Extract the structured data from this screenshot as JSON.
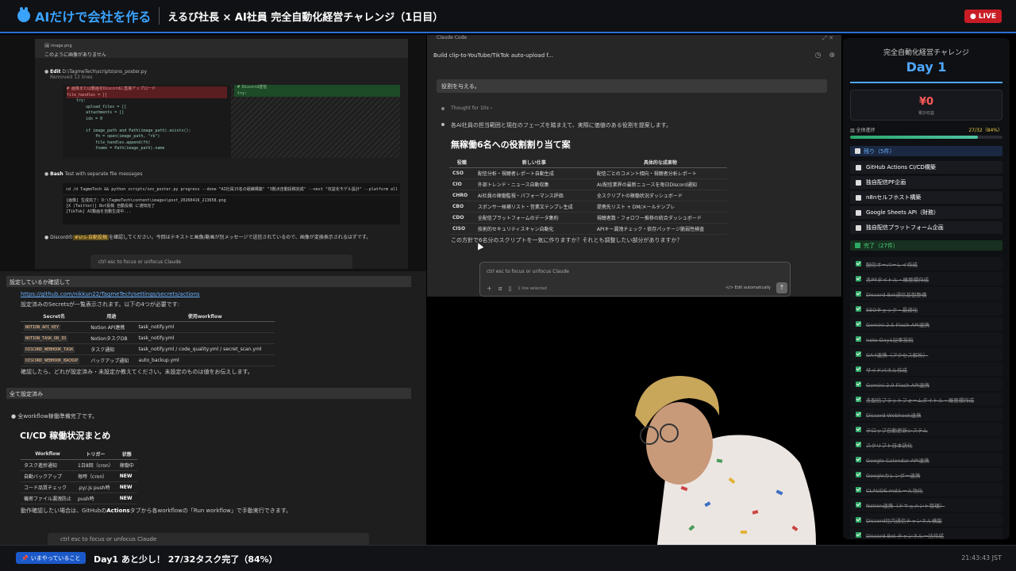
{
  "header": {
    "logo_text": "AIだけで会社を作る",
    "stream_title": "えるび社長 × AI社員 完全自動化経営チャレンジ（1日目）",
    "live_label": "LIVE",
    "accent_color": "#3aa3ff",
    "live_color": "#c81d25"
  },
  "left_top": {
    "image_chip": "image.png",
    "image_note": "このように画像がありません",
    "edit_label": "Edit",
    "edit_path": "D:\\TagmeTech\\scripts\\sns_poster.py",
    "edit_sub": "Removed 13 lines",
    "code_deleted_1": "# 画像または動画をDiscordに直接アップロード",
    "code_deleted_2": "file_handles = []",
    "code_lines": "    try:\n        upload_files = []\n        attachments = []\n        idx = 0\n\n        if image_path and Path(image_path).exists():\n            fh = open(image_path, \"rb\")\n            file_handles.append(fh)\n            fname = Path(image_path).name",
    "code_added_1": "# Discord送信",
    "code_added_2": "try:",
    "bash_label": "Bash",
    "bash_desc": "Test with separate file messages",
    "bash_cmd": "cd /d TagmeTech && python scripts/sns_poster.py progress --done \"AI社員15名の組織構築\" \"3拠点自動投稿完成\" --next \"収益化モデル設計\" --platform all 2>&1",
    "bash_out": "[画像] 生成完了: D:\\TagmeTech\\content\\images\\post_20260416_213658.png\n[X (Twitter)] Bot投稿 自動投稿 に通知完了\n[TikTok] AI動画を自動生成中...",
    "discord_before": "Discordの",
    "discord_channel": "#sns-自動投稿",
    "discord_after": "を確認してください。今回はテキストと画像/動画が別メッセージで送信されているので、画像が変換表示されるはずです。",
    "input_placeholder": "ctrl esc to focus or unfocus Claude"
  },
  "left_bottom": {
    "bar1": "設定しているか確認して",
    "gh_link": "https://github.com/nikkun22/TagmeTech/settings/secrets/actions",
    "secrets_intro": "設定済みのSecretsが一覧表示されます。以下の4つが必要です:",
    "secrets_headers": [
      "Secret名",
      "用途",
      "使用workflow"
    ],
    "secrets_rows": [
      [
        "NOTION_API_KEY",
        "Notion API連携",
        "task_notify.yml"
      ],
      [
        "NOTION_TASK_DB_ID",
        "NotionタスクDB",
        "task_notify.yml"
      ],
      [
        "DISCORD_WEBHOOK_TASK",
        "タスク通知",
        "task_notify.yml / code_quality.yml / secret_scan.yml"
      ],
      [
        "DISCORD_WEBHOOK_BACKUP",
        "バックアップ通知",
        "auto_backup.yml"
      ]
    ],
    "confirm_note": "確認したら、どれが設定済み・未設定か教えてください。未設定のものは値をお伝えします。",
    "bar2": "全て設定済み",
    "wf_ready": "全workflow稼働準備完了です。",
    "cicd_heading": "CI/CD 稼働状況まとめ",
    "wf_headers": [
      "Workflow",
      "トリガー",
      "状態"
    ],
    "wf_rows": [
      [
        "タスク進捗通知",
        "1日8回（cron）",
        "稼働中"
      ],
      [
        "自動バックアップ",
        "毎時（cron）",
        "NEW"
      ],
      [
        "コード品質チェック",
        ".py/.js push時",
        "NEW"
      ],
      [
        "機密ファイル漏洩防止",
        "push時",
        "NEW"
      ]
    ],
    "run_note_1": "動作確認したい場合は、GitHubの",
    "run_note_bold": "Actions",
    "run_note_2": "タブから各workflowの「Run workflow」で手動実行できます。",
    "input_placeholder": "ctrl esc to focus or unfocus Claude"
  },
  "claude": {
    "tab_label": "Claude Code",
    "session_title": "Build clip-to-YouTube/TikTok auto-upload f...",
    "user_message": "役割を与える。",
    "thought": "Thought for 10s",
    "intro": "各AI社員の担当範囲と現在のフェーズを踏まえて、実際に価値のある役割を提案します。",
    "heading": "無稼働6名への役割割り当て案",
    "role_headers": [
      "役職",
      "新しい仕事",
      "具体的な成果物"
    ],
    "role_rows": [
      [
        "CSO",
        "配信分析・視聴者レポート自動生成",
        "配信ごとのコメント傾向・視聴者分析レポート"
      ],
      [
        "CIO",
        "外部トレンド・ニュース自動収集",
        "AI/配信業界の最新ニュースを毎日Discord通知"
      ],
      [
        "CHRO",
        "AI社員の稼働監視・パフォーマンス評価",
        "全スクリプトの稼働状況ダッシュボード"
      ],
      [
        "CBO",
        "スポンサー候補リスト・営業文テンプレ生成",
        "提携先リスト + DM/メールテンプレ"
      ],
      [
        "CDO",
        "全配信プラットフォームのデータ集約",
        "視聴者数・フォロワー推移の統合ダッシュボード"
      ],
      [
        "CISO",
        "技術的セキュリティスキャン自動化",
        "APIキー漏洩チェック・依存パッケージ脆弱性検査"
      ]
    ],
    "question": "この方針で6名分のスクリプトを一気に作りますか？それとも調整したい部分がありますか？",
    "input_placeholder": "ctrl esc to focus or unfocus Claude",
    "lines_selected": "1 line selected",
    "edit_mode": "Edit automatically"
  },
  "sidebar": {
    "title": "完全自動化経営チャレンジ",
    "day": "Day 1",
    "revenue": "¥0",
    "revenue_label": "累計収益",
    "progress_label": "全体進捗",
    "progress_value": "27/32（84%）",
    "progress_fraction": 0.84,
    "remaining_header": "残り（5件）",
    "remaining": [
      "GitHub Actions CI/CD構築",
      "独自配信PF企画",
      "n8nセルフホスト構築",
      "Google Sheets API（財務）",
      "独自配信プラットフォーム企画"
    ],
    "done_header": "完了（27件）",
    "done": [
      "配信オーバーレイ作成",
      "各PFタイトル・概要欄作成",
      "Discord Bot通信基盤整備",
      "SEOチェック・最適化",
      "Gemini 2.5 Flash API連携",
      "note Day1記事投稿",
      "GA4連携（アクセス解析）",
      "サイドパネル作成",
      "Gemini 2.0 Flash API連携",
      "各配信プラットフォームタイトル・概要欄作成",
      "Discord Webhook連携",
      "テロップ自動更新システム",
      "スクリプト日本語化",
      "Google Calendar API連携",
      "Googleカレンダー連携",
      "CLAUDE.mdルール強化",
      "Notion連携（ドキュメント管理）",
      "Discord社内通信チャンネル構築",
      "Discord Bot チャンネル一括作成"
    ]
  },
  "footer": {
    "now_label": "いまやっていること",
    "now_text": "Day1 あと少し！ 27/32タスク完了（84%）",
    "clock": "21:43:43 JST"
  }
}
